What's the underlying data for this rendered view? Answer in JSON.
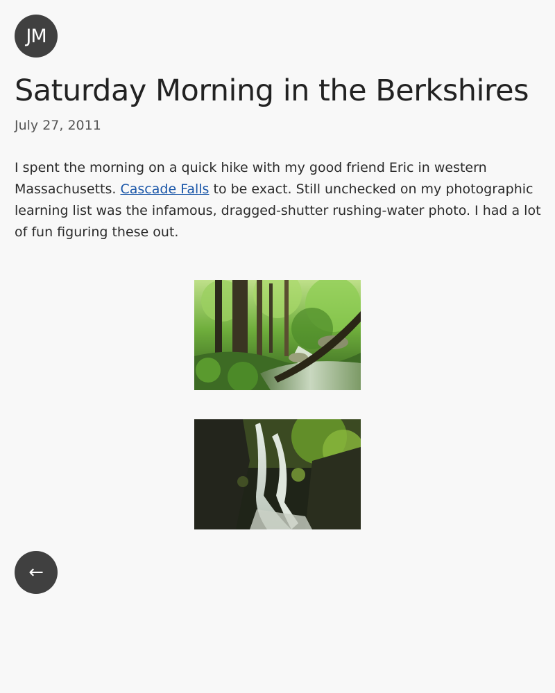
{
  "header": {
    "avatar_initials": "JM"
  },
  "post": {
    "title": "Saturday Morning in the Berkshires",
    "date": "July 27, 2011",
    "body_before_link": "I spent the morning on a quick hike with my good friend Eric in western Massachusetts. ",
    "link_text": "Cascade Falls",
    "body_after_link": " to be exact. Still unchecked on my photographic learning list was the infamous, dragged-shutter rushing-water photo. I had a lot of fun figuring these out."
  },
  "footer": {
    "back_icon": "←"
  },
  "colors": {
    "background": "#f8f8f8",
    "circle_button": "#404040",
    "link": "#1a56a8"
  }
}
